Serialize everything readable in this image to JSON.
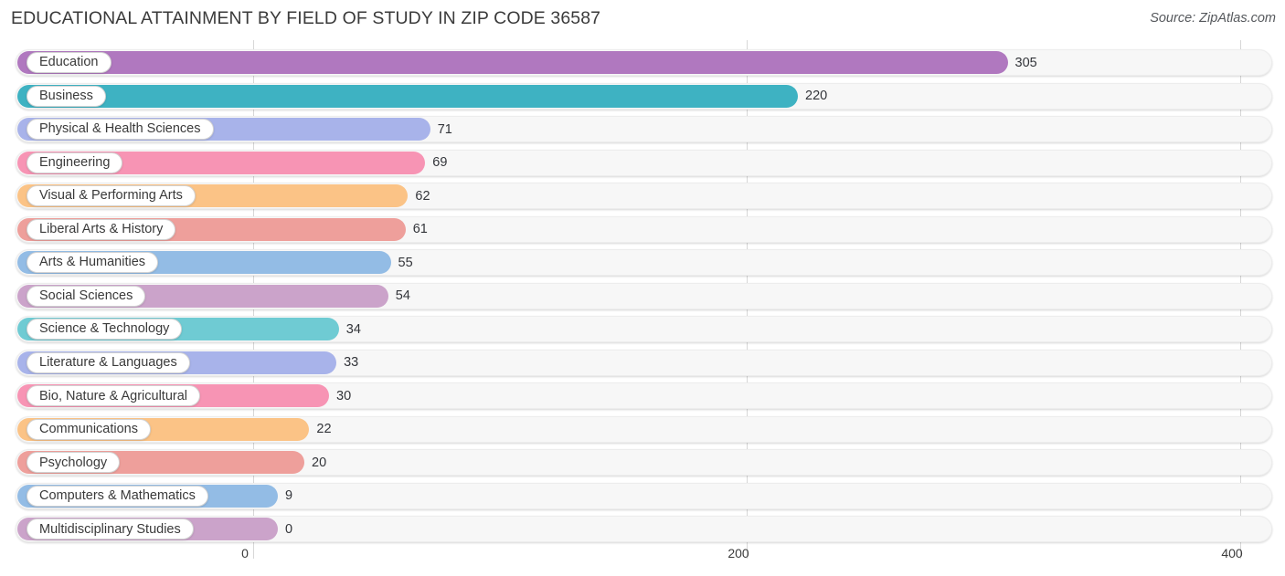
{
  "header": {
    "title": "EDUCATIONAL ATTAINMENT BY FIELD OF STUDY IN ZIP CODE 36587",
    "source": "Source: ZipAtlas.com"
  },
  "chart_data": {
    "type": "bar",
    "orientation": "horizontal",
    "title": "EDUCATIONAL ATTAINMENT BY FIELD OF STUDY IN ZIP CODE 36587",
    "subtitle": "",
    "xlabel": "",
    "ylabel": "",
    "xlim": [
      0,
      400
    ],
    "grid": true,
    "legend": null,
    "xticks": [
      "0",
      "200",
      "400"
    ],
    "xtick_values": [
      0,
      200,
      400
    ],
    "categories": [
      "Education",
      "Business",
      "Physical & Health Sciences",
      "Engineering",
      "Visual & Performing Arts",
      "Liberal Arts & History",
      "Arts & Humanities",
      "Social Sciences",
      "Science & Technology",
      "Literature & Languages",
      "Bio, Nature & Agricultural",
      "Communications",
      "Psychology",
      "Computers & Mathematics",
      "Multidisciplinary Studies"
    ],
    "values": [
      305,
      220,
      71,
      69,
      62,
      61,
      55,
      54,
      34,
      33,
      30,
      22,
      20,
      9,
      0
    ],
    "value_labels": [
      "305",
      "220",
      "71",
      "69",
      "62",
      "61",
      "55",
      "54",
      "34",
      "33",
      "30",
      "22",
      "20",
      "9",
      "0"
    ],
    "colors": [
      "#b078bf",
      "#3eb2c2",
      "#a8b3ea",
      "#f794b4",
      "#fbc386",
      "#ee9f9b",
      "#93bce5",
      "#cba3ca",
      "#6fcbd3",
      "#a8b3ea",
      "#f794b4",
      "#fbc386",
      "#ee9f9b",
      "#93bce5",
      "#cba3ca"
    ]
  }
}
